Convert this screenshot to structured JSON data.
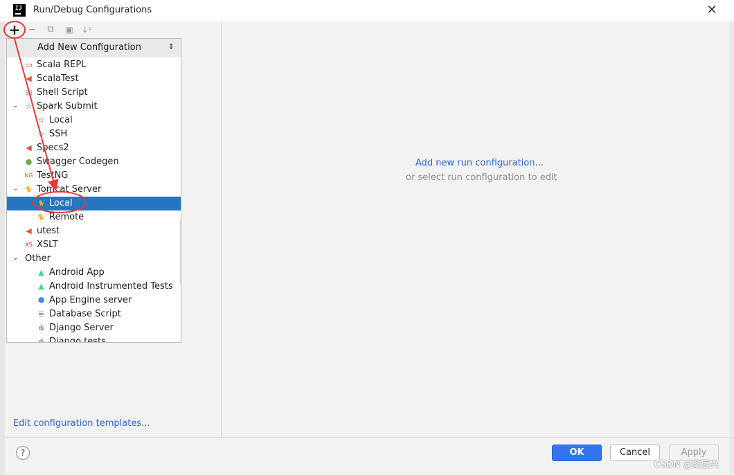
{
  "window": {
    "title": "Run/Debug Configurations",
    "app_icon_text": "IJ",
    "close_glyph": "✕"
  },
  "toolbar": {
    "add_glyph": "+",
    "remove_glyph": "−",
    "copy_glyph": "⧉",
    "folder_glyph": "▣",
    "sort_glyph": "↓ᶻ"
  },
  "popup": {
    "title": "Add New Configuration",
    "collapse_glyph": "⇟"
  },
  "tree": [
    {
      "label": "Scala REPL",
      "icon": "scala-repl-icon",
      "glyph": "▭",
      "color": "#cc3333",
      "depth": 1,
      "chevron": ""
    },
    {
      "label": "ScalaTest",
      "icon": "scalatest-icon",
      "glyph": "◀",
      "color": "#e4572e",
      "depth": 1,
      "chevron": ""
    },
    {
      "label": "Shell Script",
      "icon": "shell-script-icon",
      "glyph": "▤",
      "color": "#9a9a9a",
      "depth": 1,
      "chevron": ""
    },
    {
      "label": "Spark Submit",
      "icon": "spark-icon",
      "glyph": "☆",
      "color": "#555555",
      "depth": 1,
      "chevron": "⌄"
    },
    {
      "label": "Local",
      "icon": "spark-local-icon",
      "glyph": "☆",
      "color": "#555555",
      "depth": 2,
      "chevron": ""
    },
    {
      "label": "SSH",
      "icon": "spark-ssh-icon",
      "glyph": "☆",
      "color": "#555555",
      "depth": 2,
      "chevron": ""
    },
    {
      "label": "Specs2",
      "icon": "specs2-icon",
      "glyph": "◀",
      "color": "#e4572e",
      "depth": 1,
      "chevron": ""
    },
    {
      "label": "Swagger Codegen",
      "icon": "swagger-icon",
      "glyph": "●",
      "color": "#6fa84f",
      "depth": 1,
      "chevron": ""
    },
    {
      "label": "TestNG",
      "icon": "testng-icon",
      "glyph": "NG",
      "color": "#e05a2a",
      "depth": 1,
      "chevron": ""
    },
    {
      "label": "Tomcat Server",
      "icon": "tomcat-icon",
      "glyph": "🐈",
      "color": "#b3862a",
      "depth": 1,
      "chevron": "⌄"
    },
    {
      "label": "Local",
      "icon": "tomcat-local-icon",
      "glyph": "🐈",
      "color": "#b3862a",
      "depth": 2,
      "chevron": "",
      "selected": true
    },
    {
      "label": "Remote",
      "icon": "tomcat-remote-icon",
      "glyph": "🐈",
      "color": "#b3862a",
      "depth": 2,
      "chevron": ""
    },
    {
      "label": "utest",
      "icon": "utest-icon",
      "glyph": "◀",
      "color": "#e4572e",
      "depth": 1,
      "chevron": ""
    },
    {
      "label": "XSLT",
      "icon": "xslt-icon",
      "glyph": "XS",
      "color": "#cc2222",
      "depth": 1,
      "chevron": ""
    },
    {
      "label": "Other",
      "icon": "",
      "glyph": "",
      "color": "#444444",
      "depth": 0,
      "chevron": "⌄"
    },
    {
      "label": "Android App",
      "icon": "android-icon",
      "glyph": "▲",
      "color": "#3ddc84",
      "depth": 2,
      "chevron": ""
    },
    {
      "label": "Android Instrumented Tests",
      "icon": "android-test-icon",
      "glyph": "▲",
      "color": "#3ddc84",
      "depth": 2,
      "chevron": ""
    },
    {
      "label": "App Engine server",
      "icon": "app-engine-icon",
      "glyph": "⬢",
      "color": "#4a86e8",
      "depth": 2,
      "chevron": ""
    },
    {
      "label": "Database Script",
      "icon": "database-script-icon",
      "glyph": "≣",
      "color": "#7a7a7a",
      "depth": 2,
      "chevron": ""
    },
    {
      "label": "Django Server",
      "icon": "django-icon",
      "glyph": "dj",
      "color": "#0c3c26",
      "depth": 2,
      "chevron": ""
    },
    {
      "label": "Django tests",
      "icon": "django-tests-icon",
      "glyph": "dj",
      "color": "#0c3c26",
      "depth": 2,
      "chevron": ""
    }
  ],
  "main": {
    "add_link": "Add new run configuration...",
    "sub_text": "or select run configuration to edit"
  },
  "left_footer": {
    "templates_link": "Edit configuration templates..."
  },
  "footer": {
    "help_glyph": "?",
    "ok_label": "OK",
    "cancel_label": "Cancel",
    "apply_label": "Apply"
  },
  "watermark": "CSDN @梁辰兴",
  "colors": {
    "selection": "#2675bf",
    "link": "#2f65ca",
    "ok_button": "#3574f0",
    "annotation": "#e53935"
  }
}
